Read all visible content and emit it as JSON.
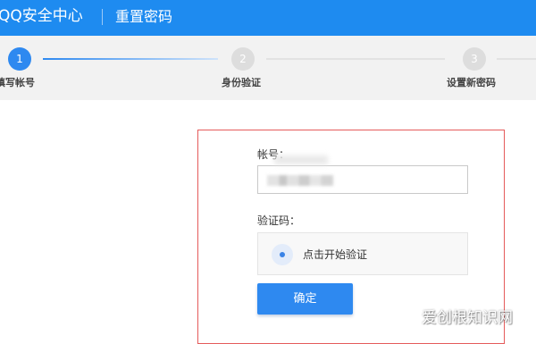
{
  "header": {
    "brand": "QQ安全中心",
    "page_title": "重置密码"
  },
  "steps": [
    {
      "number": "1",
      "label": "填写帐号",
      "state": "active"
    },
    {
      "number": "2",
      "label": "身份验证",
      "state": "inactive"
    },
    {
      "number": "3",
      "label": "设置新密码",
      "state": "inactive"
    }
  ],
  "form": {
    "account_label": "帐号：",
    "account_value_blurred": true,
    "captcha_label": "验证码：",
    "verify_button_label": "点击开始验证",
    "confirm_button_label": "确定"
  },
  "watermark": "爱创根知识网",
  "colors": {
    "header": "#1e8bf0",
    "accent": "#2e89f0",
    "panel_border": "#e55b5b"
  }
}
